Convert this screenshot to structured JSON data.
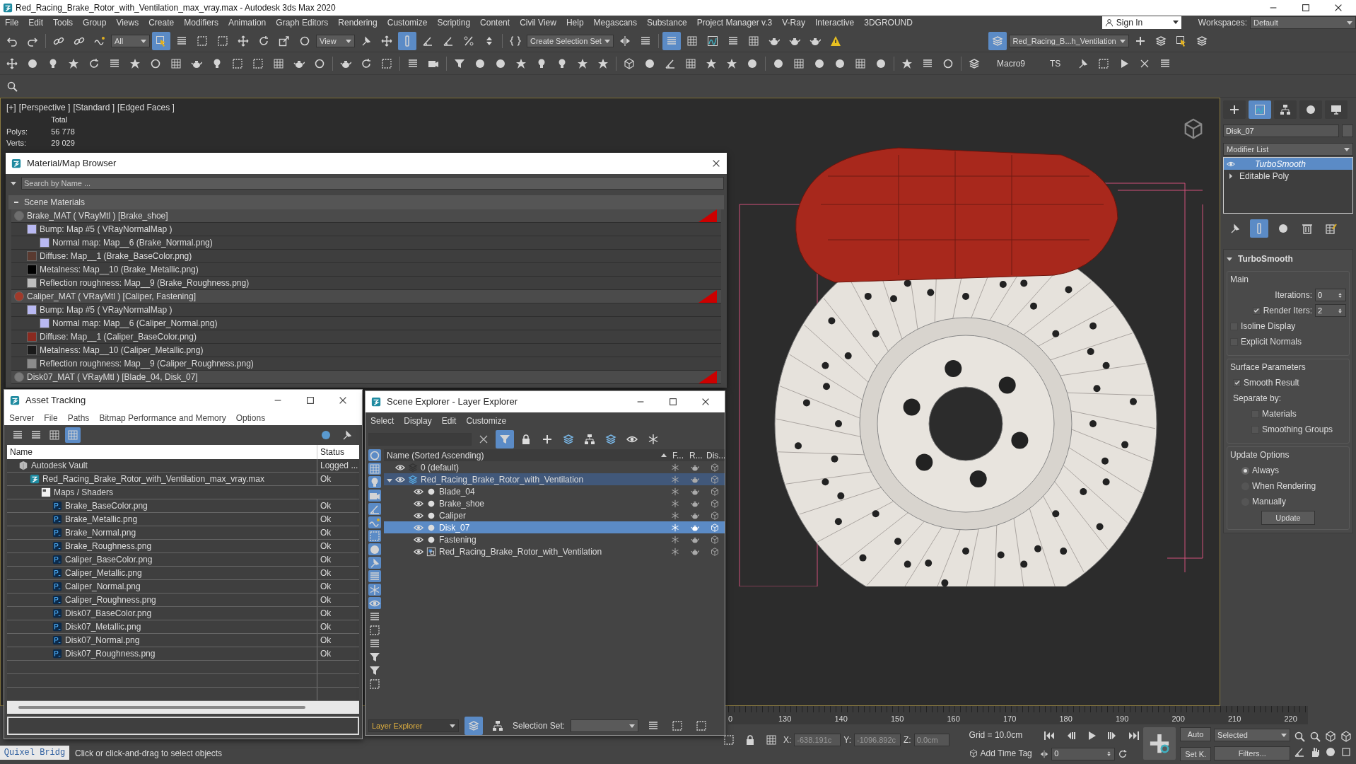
{
  "window": {
    "title": "Red_Racing_Brake_Rotor_with_Ventilation_max_vray.max - Autodesk 3ds Max 2020"
  },
  "menu": [
    "File",
    "Edit",
    "Tools",
    "Group",
    "Views",
    "Create",
    "Modifiers",
    "Animation",
    "Graph Editors",
    "Rendering",
    "Customize",
    "Scripting",
    "Content",
    "Civil View",
    "Help",
    "Megascans",
    "Substance",
    "Project Manager v.3",
    "V-Ray",
    "Interactive",
    "3DGROUND"
  ],
  "sign_in": "Sign In",
  "workspaces": {
    "label": "Workspaces:",
    "value": "Default"
  },
  "toolbar": {
    "selection_filter": "All",
    "reference_coord": "View",
    "selection_set": "Create Selection Set",
    "layer": "Red_Racing_B...h_Ventilation",
    "macro": "Macro9",
    "ts": "TS",
    "toggles": [
      {
        "on": true
      },
      {
        "on": true
      },
      {
        "on": true
      },
      {
        "on": true
      }
    ]
  },
  "viewport": {
    "labels": [
      "[+]",
      "[Perspective ]",
      "[Standard ]",
      "[Edged Faces ]"
    ],
    "stats": {
      "header": "Total",
      "rows": [
        {
          "label": "Polys:",
          "value": "56 778"
        },
        {
          "label": "Verts:",
          "value": "29 029"
        }
      ]
    }
  },
  "material_browser": {
    "title": "Material/Map Browser",
    "search": {
      "placeholder": "Search by Name ..."
    },
    "group": {
      "label": "Scene Materials",
      "expanded": true
    },
    "items": [
      {
        "kind": "material",
        "label": "Brake_MAT ( VRayMtl ) [Brake_shoe]",
        "color": "#6e6e6e",
        "children": [
          {
            "kind": "map",
            "label": "Bump: Map #5 ( VRayNormalMap )",
            "color": "#b9b9f2",
            "children": [
              {
                "kind": "map",
                "label": "Normal map: Map__6 (Brake_Normal.png)",
                "color": "#b9b9f2"
              }
            ]
          },
          {
            "kind": "map",
            "label": "Diffuse: Map__1 (Brake_BaseColor.png)",
            "color": "#5a3a30"
          },
          {
            "kind": "map",
            "label": "Metalness: Map__10 (Brake_Metallic.png)",
            "color": "#000000"
          },
          {
            "kind": "map",
            "label": "Reflection roughness: Map__9 (Brake_Roughness.png)",
            "color": "#bdbdbd"
          }
        ]
      },
      {
        "kind": "material",
        "label": "Caliper_MAT ( VRayMtl ) [Caliper, Fastening]",
        "color": "#a03a2a",
        "children": [
          {
            "kind": "map",
            "label": "Bump: Map #5 ( VRayNormalMap )",
            "color": "#b9b9f2",
            "children": [
              {
                "kind": "map",
                "label": "Normal map: Map__6 (Caliper_Normal.png)",
                "color": "#b9b9f2"
              }
            ]
          },
          {
            "kind": "map",
            "label": "Diffuse: Map__1 (Caliper_BaseColor.png)",
            "color": "#8a2a20"
          },
          {
            "kind": "map",
            "label": "Metalness: Map__10 (Caliper_Metallic.png)",
            "color": "#1a1a1a"
          },
          {
            "kind": "map",
            "label": "Reflection roughness: Map__9 (Caliper_Roughness.png)",
            "color": "#8c8c8c"
          }
        ]
      },
      {
        "kind": "material",
        "label": "Disk07_MAT ( VRayMtl ) [Blade_04, Disk_07]",
        "color": "#7a7a7a"
      }
    ]
  },
  "asset_tracking": {
    "title": "Asset Tracking",
    "menu": [
      "Server",
      "File",
      "Paths",
      "Bitmap Performance and Memory",
      "Options"
    ],
    "views": [
      {
        "selected": false
      },
      {
        "selected": false
      },
      {
        "selected": false
      },
      {
        "selected": true
      }
    ],
    "columns": [
      "Name",
      "Status"
    ],
    "rows": [
      {
        "kind": "vault",
        "name": "Autodesk Vault",
        "status": "Logged ...",
        "children": [
          {
            "kind": "scene",
            "name": "Red_Racing_Brake_Rotor_with_Ventilation_max_vray.max",
            "status": "Ok",
            "children": [
              {
                "kind": "folder",
                "name": "Maps / Shaders",
                "children": [
                  {
                    "kind": "image",
                    "name": "Brake_BaseColor.png",
                    "status": "Ok"
                  },
                  {
                    "kind": "image",
                    "name": "Brake_Metallic.png",
                    "status": "Ok"
                  },
                  {
                    "kind": "image",
                    "name": "Brake_Normal.png",
                    "status": "Ok"
                  },
                  {
                    "kind": "image",
                    "name": "Brake_Roughness.png",
                    "status": "Ok"
                  },
                  {
                    "kind": "image",
                    "name": "Caliper_BaseColor.png",
                    "status": "Ok"
                  },
                  {
                    "kind": "image",
                    "name": "Caliper_Metallic.png",
                    "status": "Ok"
                  },
                  {
                    "kind": "image",
                    "name": "Caliper_Normal.png",
                    "status": "Ok"
                  },
                  {
                    "kind": "image",
                    "name": "Caliper_Roughness.png",
                    "status": "Ok"
                  },
                  {
                    "kind": "image",
                    "name": "Disk07_BaseColor.png",
                    "status": "Ok"
                  },
                  {
                    "kind": "image",
                    "name": "Disk07_Metallic.png",
                    "status": "Ok"
                  },
                  {
                    "kind": "image",
                    "name": "Disk07_Normal.png",
                    "status": "Ok"
                  },
                  {
                    "kind": "image",
                    "name": "Disk07_Roughness.png",
                    "status": "Ok"
                  }
                ]
              }
            ]
          }
        ]
      }
    ]
  },
  "scene_explorer": {
    "title": "Scene Explorer - Layer Explorer",
    "menu": [
      "Select",
      "Display",
      "Edit",
      "Customize"
    ],
    "filter_on": true,
    "filters": [
      {
        "on": true
      },
      {
        "on": true
      },
      {
        "on": true
      },
      {
        "on": true
      },
      {
        "on": true
      },
      {
        "on": true
      },
      {
        "on": true
      },
      {
        "on": true
      },
      {
        "on": true
      },
      {
        "on": true
      },
      {
        "on": true
      },
      {
        "on": true
      }
    ],
    "columns": [
      "Name (Sorted Ascending)",
      "F...",
      "R...",
      "Dis..."
    ],
    "rows": [
      {
        "kind": "layer",
        "name": "0 (default)",
        "selected": false,
        "active": false
      },
      {
        "kind": "layer",
        "name": "Red_Racing_Brake_Rotor_with_Ventilation",
        "selected": false,
        "active": true,
        "expanded": true,
        "children": [
          {
            "kind": "object",
            "name": "Blade_04",
            "selected": false,
            "active": false
          },
          {
            "kind": "object",
            "name": "Brake_shoe",
            "selected": false,
            "active": false
          },
          {
            "kind": "object",
            "name": "Caliper",
            "selected": false,
            "active": false
          },
          {
            "kind": "object",
            "name": "Disk_07",
            "selected": true,
            "active": false
          },
          {
            "kind": "object",
            "name": "Fastening",
            "selected": false,
            "active": false
          },
          {
            "kind": "group",
            "name": "Red_Racing_Brake_Rotor_with_Ventilation",
            "selected": false,
            "active": false
          }
        ]
      }
    ],
    "footer": {
      "explorer": "Layer Explorer",
      "selection_set": "Selection Set:"
    }
  },
  "command_panel": {
    "tabs": [
      {
        "selected": false
      },
      {
        "selected": true
      },
      {
        "selected": false
      },
      {
        "selected": false
      },
      {
        "selected": false
      }
    ],
    "object_name": "Disk_07",
    "modifier_list": "Modifier List",
    "stack": [
      {
        "kind": "modifier",
        "label": "TurboSmooth",
        "selected": true
      },
      {
        "kind": "base",
        "label": "Editable Poly",
        "selected": false
      }
    ],
    "rollout": {
      "title": "TurboSmooth",
      "main": {
        "title": "Main",
        "iterations": {
          "label": "Iterations:",
          "value": "0"
        },
        "render_iters": {
          "label": "Render Iters:",
          "value": "2",
          "checked": true
        },
        "options": [
          {
            "label": "Isoline Display",
            "checked": false
          },
          {
            "label": "Explicit Normals",
            "checked": false
          }
        ]
      },
      "surface": {
        "title": "Surface Parameters",
        "smooth_result": {
          "label": "Smooth Result",
          "checked": true
        },
        "separate_by": "Separate by:",
        "options": [
          {
            "label": "Materials",
            "checked": false
          },
          {
            "label": "Smoothing Groups",
            "checked": false
          }
        ]
      },
      "update": {
        "title": "Update Options",
        "radios": [
          {
            "label": "Always",
            "selected": true
          },
          {
            "label": "When Rendering",
            "selected": false
          },
          {
            "label": "Manually",
            "selected": false
          }
        ],
        "button": "Update"
      }
    }
  },
  "timeline": {
    "ticks": [
      "0",
      "130",
      "140",
      "150",
      "160",
      "170",
      "180",
      "190",
      "200",
      "210",
      "220"
    ]
  },
  "status": {
    "quixel": "Quixel Bridg",
    "prompt": "Click or click-and-drag to select objects",
    "x": {
      "label": "X:",
      "value": "-638.191c"
    },
    "y": {
      "label": "Y:",
      "value": "-1096.892c"
    },
    "z": {
      "label": "Z:",
      "value": "0.0cm"
    },
    "grid": "Grid = 10.0cm",
    "time_tag": "Add Time Tag",
    "frame": "0",
    "auto": "Auto",
    "set_key": "Set K.",
    "key_filter": "Selected",
    "filters": "Filters..."
  }
}
